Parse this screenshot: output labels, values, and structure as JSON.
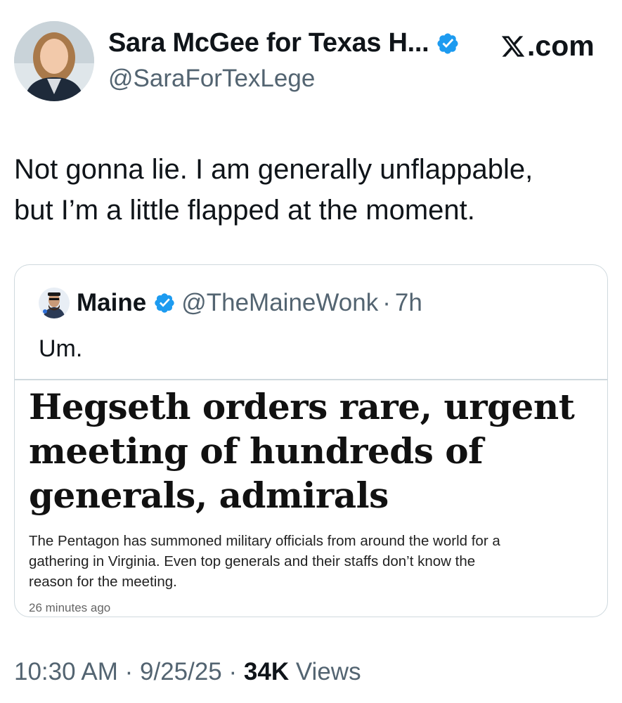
{
  "author": {
    "display_name": "Sara McGee for Texas H...",
    "handle": "@SaraForTexLege",
    "avatar_icon": "profile-photo-woman",
    "verified_icon": "verified-badge-icon"
  },
  "brand": {
    "label": ".com",
    "icon": "x-logo-icon"
  },
  "tweet": {
    "text_line1": "Not gonna lie. I am generally unflappable,",
    "text_line2": "but I’m a little flapped at the moment."
  },
  "quote": {
    "display_name": "Maine",
    "handle": "@TheMaineWonk",
    "separator": "·",
    "time": "7h",
    "text": "Um.",
    "article": {
      "title_line1": "Hegseth orders rare, urgent",
      "title_line2": "meeting of hundreds of",
      "title_line3": "generals, admirals",
      "summary_line1": "The Pentagon has summoned military officials from around the world for a",
      "summary_line2": "gathering in Virginia. Even top generals and their staffs don’t know the",
      "summary_line3": "reason for the meeting.",
      "time": "26 minutes ago"
    }
  },
  "footer": {
    "time": "10:30 AM",
    "sep1": " · ",
    "date": "9/25/25",
    "sep2": " · ",
    "views_count": "34K",
    "views_label": " Views"
  },
  "colors": {
    "verified_blue": "#1d9bf0",
    "secondary_text": "#536471",
    "border": "#cfd9de"
  }
}
